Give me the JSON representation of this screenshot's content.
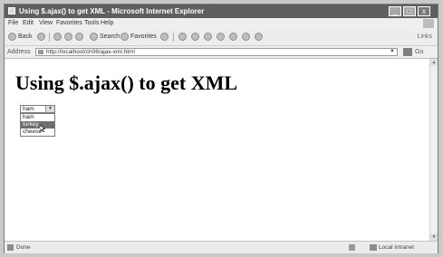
{
  "window": {
    "title": "Using $.ajax() to get XML - Microsoft Internet Explorer"
  },
  "menubar": {
    "items": [
      "File",
      "Edit",
      "View",
      "Favorites",
      "Tools",
      "Help"
    ]
  },
  "toolbar": {
    "back_label": "Back",
    "search_label": "Search",
    "favorites_label": "Favorites",
    "links_label": "Links"
  },
  "address": {
    "label": "Address",
    "url": "http://localhost/ch06/ajax-xml.html",
    "go_label": "Go"
  },
  "page": {
    "heading": "Using $.ajax() to get XML",
    "select_value": "ham",
    "options": [
      "ham",
      "turkey",
      "cheese"
    ],
    "highlighted_option": "turkey"
  },
  "status": {
    "text": "Done",
    "zone": "Local intranet"
  }
}
